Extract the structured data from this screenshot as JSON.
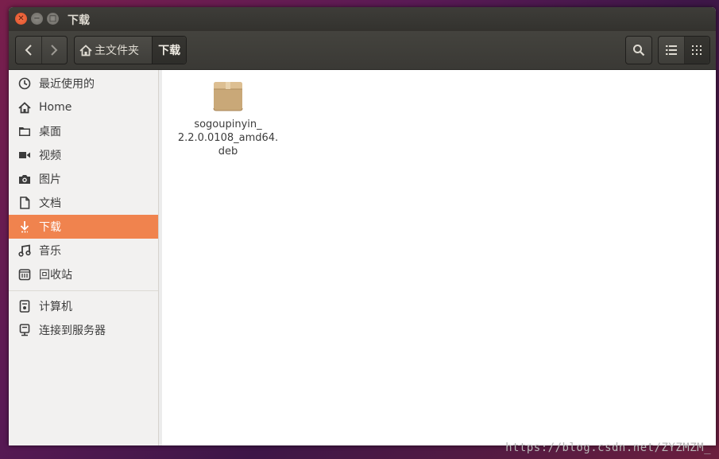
{
  "window": {
    "title": "下载"
  },
  "toolbar": {
    "breadcrumb": [
      {
        "label": "主文件夹"
      },
      {
        "label": "下载"
      }
    ]
  },
  "sidebar": {
    "items": [
      {
        "label": "最近使用的",
        "icon": "clock-icon"
      },
      {
        "label": "Home",
        "icon": "home-icon"
      },
      {
        "label": "桌面",
        "icon": "folder-icon"
      },
      {
        "label": "视频",
        "icon": "video-icon"
      },
      {
        "label": "图片",
        "icon": "camera-icon"
      },
      {
        "label": "文档",
        "icon": "document-icon"
      },
      {
        "label": "下载",
        "icon": "download-icon",
        "active": true
      },
      {
        "label": "音乐",
        "icon": "music-icon"
      },
      {
        "label": "回收站",
        "icon": "trash-icon"
      },
      {
        "label": "计算机",
        "icon": "computer-icon"
      },
      {
        "label": "连接到服务器",
        "icon": "server-icon"
      }
    ]
  },
  "files": [
    {
      "name_line1": "sogoupinyin_",
      "name_line2": "2.2.0.0108_amd64.",
      "name_line3": "deb",
      "icon": "package-icon"
    }
  ],
  "watermark": "https://blog.csdn.net/ZYZMZM_",
  "colors": {
    "accent": "#f0834e",
    "toolbar": "#3e3d39"
  }
}
